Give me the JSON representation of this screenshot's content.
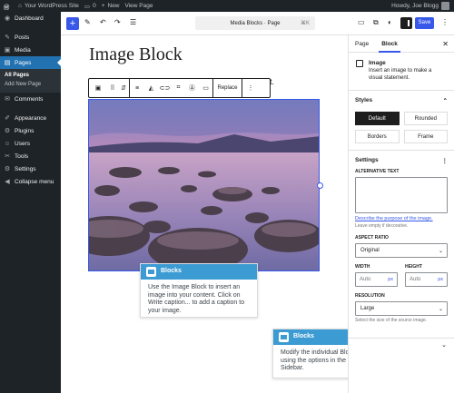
{
  "admin_bar": {
    "site": "Your WordPress Site",
    "comments": "0",
    "new": "New",
    "view": "View Page",
    "howdy": "Howdy, Joe Blogg"
  },
  "menu": {
    "items": [
      {
        "icon": "dashboard-icon",
        "label": "Dashboard",
        "glyph": "◉"
      },
      {
        "icon": "pin-icon",
        "label": "Posts",
        "glyph": "✎"
      },
      {
        "icon": "media-icon",
        "label": "Media",
        "glyph": "▣"
      },
      {
        "icon": "pages-icon",
        "label": "Pages",
        "glyph": "▤"
      }
    ],
    "sub": [
      "All Pages",
      "Add New Page"
    ],
    "items2": [
      {
        "icon": "comments-icon",
        "label": "Comments",
        "glyph": "✉"
      },
      {
        "icon": "appearance-icon",
        "label": "Appearance",
        "glyph": "✐"
      },
      {
        "icon": "plugins-icon",
        "label": "Plugins",
        "glyph": "⚙"
      },
      {
        "icon": "users-icon",
        "label": "Users",
        "glyph": "☺"
      },
      {
        "icon": "tools-icon",
        "label": "Tools",
        "glyph": "✂"
      },
      {
        "icon": "settings-icon",
        "label": "Settings",
        "glyph": "⚙"
      },
      {
        "icon": "collapse-icon",
        "label": "Collapse menu",
        "glyph": "◀"
      }
    ]
  },
  "toolbar": {
    "command": "Media Blocks · Page",
    "shortcut": "⌘K",
    "save": "Save"
  },
  "editor": {
    "title": "Image Block",
    "ghost": "elit.",
    "replace": "Replace"
  },
  "tip1": {
    "title": "Blocks",
    "body": "Use the Image Block to insert an image into your content. Click on Write caption... to add a caption to your image."
  },
  "tip2": {
    "title": "Blocks",
    "body": "Modify the individual Block Settings using the options in the Settings Sidebar."
  },
  "sidebar": {
    "tab_page": "Page",
    "tab_block": "Block",
    "block_name": "Image",
    "block_desc": "Insert an image to make a visual statement.",
    "styles_title": "Styles",
    "styles": [
      "Default",
      "Rounded",
      "Borders",
      "Frame"
    ],
    "settings_title": "Settings",
    "alt_label": "ALTERNATIVE TEXT",
    "alt_link": "Describe the purpose of the image.",
    "alt_hint": "Leave empty if decorative.",
    "aspect_label": "ASPECT RATIO",
    "aspect_value": "Original",
    "width_label": "WIDTH",
    "height_label": "HEIGHT",
    "auto": "Auto",
    "unit": "px",
    "res_label": "RESOLUTION",
    "res_value": "Large",
    "res_hint": "Select the size of the source image."
  },
  "colors": {
    "accent": "#3858e9",
    "admin_bg": "#1d2327",
    "tip_header": "#3c9bd3"
  }
}
